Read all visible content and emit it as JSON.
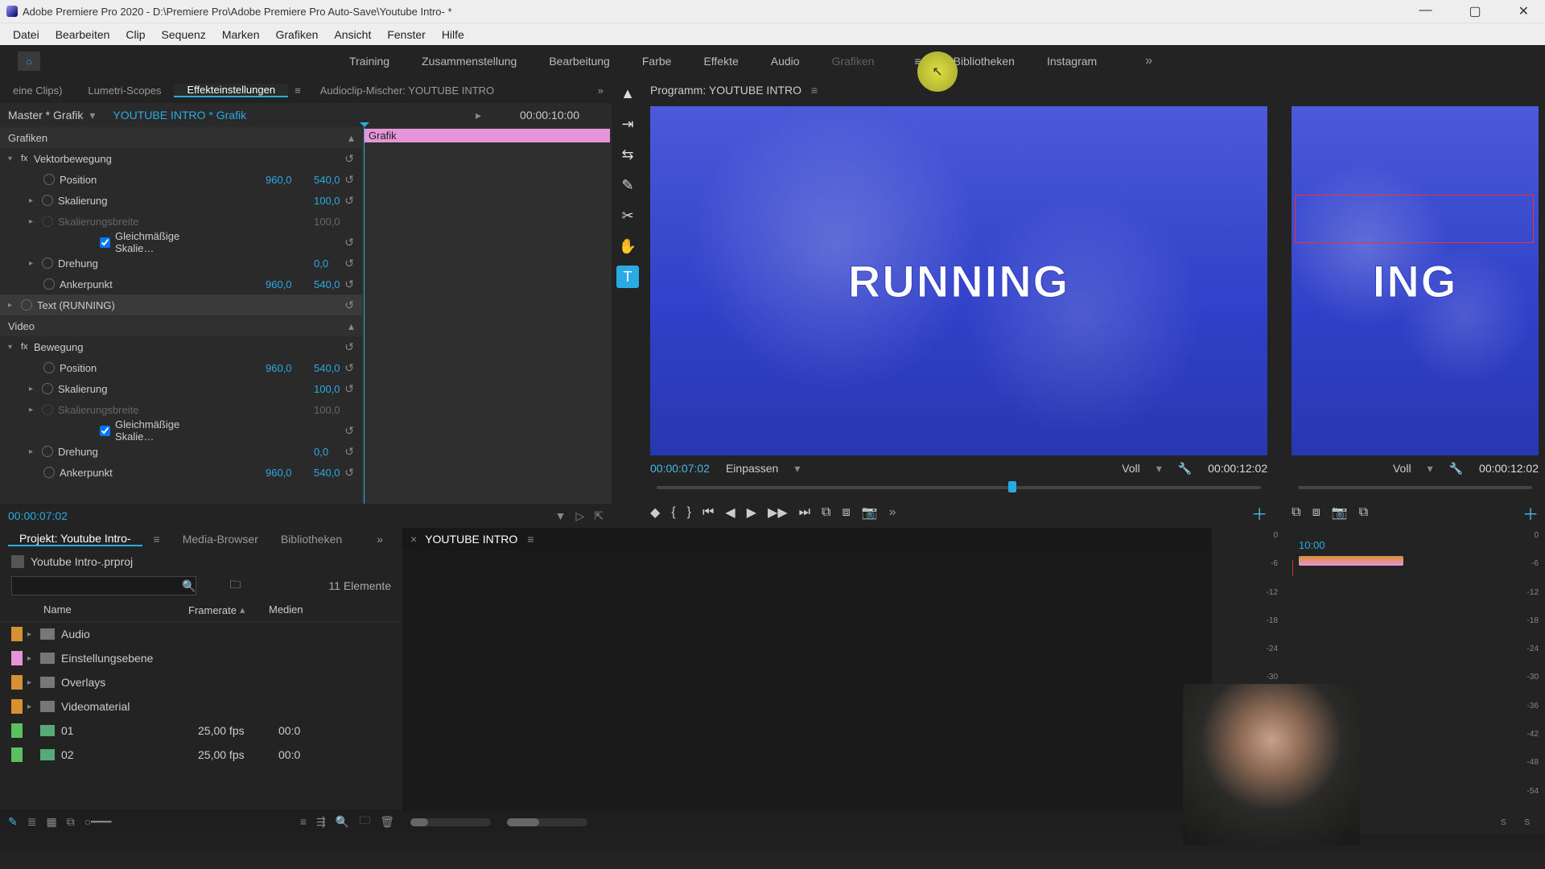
{
  "title_bar": {
    "text": "Adobe Premiere Pro 2020 - D:\\Premiere Pro\\Adobe Premiere Pro Auto-Save\\Youtube Intro- *",
    "min": "—",
    "max": "▢",
    "close": "✕"
  },
  "menu": [
    "Datei",
    "Bearbeiten",
    "Clip",
    "Sequenz",
    "Marken",
    "Grafiken",
    "Ansicht",
    "Fenster",
    "Hilfe"
  ],
  "workspaces": {
    "items": [
      "Training",
      "Zusammenstellung",
      "Bearbeitung",
      "Farbe",
      "Effekte",
      "Audio",
      "Grafiken",
      "Bibliotheken",
      "Instagram"
    ],
    "overflow": "»",
    "highlight_cursor": "▲"
  },
  "fx": {
    "tabs": {
      "t0": "eine Clips)",
      "t1": "Lumetri-Scopes",
      "t2": "Effekteinstellungen",
      "t3": "Audioclip-Mischer: YOUTUBE INTRO"
    },
    "overflow": "»",
    "head": {
      "master": "Master * Grafik",
      "arrow": "▾",
      "clip": "YOUTUBE INTRO * Grafik",
      "tri": "▸",
      "tc": "00:00:10:00"
    },
    "clip_label": "Grafik",
    "sections": {
      "grafiken": "Grafiken",
      "vektor": "Vektorbewegung",
      "text": "Text (RUNNING)",
      "video": "Video",
      "bewegung": "Bewegung"
    },
    "props": {
      "position": "Position",
      "skalierung": "Skalierung",
      "skalierungsbreite": "Skalierungsbreite",
      "gleich": "Gleichmäßige Skalie…",
      "drehung": "Drehung",
      "ankerpunkt": "Ankerpunkt"
    },
    "vals": {
      "pos_x": "960,0",
      "pos_y": "540,0",
      "scale": "100,0",
      "sbreite": "100,0",
      "rot": "0,0",
      "anchor_x": "960,0",
      "anchor_y": "540,0"
    },
    "reset": "↺",
    "foot_tc": "00:00:07:02"
  },
  "tools": {
    "items": [
      "selection",
      "track-select",
      "ripple",
      "razor",
      "pen",
      "hand",
      "type"
    ],
    "glyphs": [
      "▲",
      "⇥",
      "⇆",
      "✎",
      "✂",
      "✋",
      "T"
    ]
  },
  "program": {
    "tab": "Programm: YOUTUBE INTRO",
    "overlay_text": "RUNNING",
    "overlay_text2": "ING",
    "v1": {
      "tc_left": "00:00:07:02",
      "fit": "Einpassen",
      "quality": "Voll",
      "wrench": "🔧",
      "tc_right": "00:00:12:02"
    },
    "v2": {
      "quality": "Voll",
      "wrench": "🔧",
      "tc_right": "00:00:12:02"
    },
    "btns_glyphs": [
      "◆",
      "{",
      "}",
      "⏮",
      "◀",
      "▶",
      "▶▶",
      "⏭",
      "⧉",
      "⧈",
      "📷"
    ],
    "btns2_glyphs": [
      "⧉",
      "⧈",
      "📷",
      "⧉"
    ],
    "add": "＋",
    "chev": "»"
  },
  "project": {
    "tabs": {
      "t0": "Projekt: Youtube Intro-",
      "t1": "Media-Browser",
      "t2": "Bibliotheken"
    },
    "overflow": "»",
    "file": "Youtube Intro-.prproj",
    "search_placeholder": "",
    "count": "11 Elemente",
    "cols": {
      "c1": "Name",
      "c2": "Framerate",
      "c3": "Medien"
    },
    "rows": [
      {
        "tag": "orange",
        "type": "folder",
        "name": "Audio",
        "fr": "",
        "me": ""
      },
      {
        "tag": "pink",
        "type": "folder",
        "name": "Einstellungsebene",
        "fr": "",
        "me": ""
      },
      {
        "tag": "orange",
        "type": "folder",
        "name": "Overlays",
        "fr": "",
        "me": ""
      },
      {
        "tag": "orange",
        "type": "folder",
        "name": "Videomaterial",
        "fr": "",
        "me": ""
      },
      {
        "tag": "green",
        "type": "seq",
        "name": "01",
        "fr": "25,00 fps",
        "me": "00:0"
      },
      {
        "tag": "green",
        "type": "seq",
        "name": "02",
        "fr": "25,00 fps",
        "me": "00:0"
      }
    ]
  },
  "timeline": {
    "tab": "YOUTUBE INTRO",
    "close": "×"
  },
  "mini": {
    "tc": "10:00"
  },
  "meter_labels": [
    "0",
    "-6",
    "-12",
    "-18",
    "-24",
    "-30",
    "-36",
    "-42",
    "-48",
    "-54",
    ""
  ],
  "meter_foot": "S  S"
}
